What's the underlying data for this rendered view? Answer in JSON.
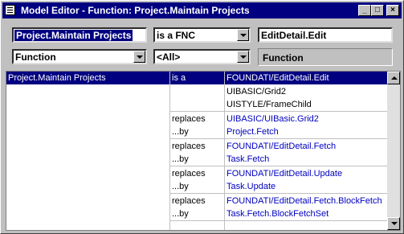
{
  "window": {
    "title": "Model Editor - Function: Project.Maintain Projects"
  },
  "controls": {
    "object_value": "Project.Maintain Projects",
    "relation_value": "is a FNC",
    "target_value": "EditDetail.Edit",
    "type_value": "Function",
    "filter_value": "<All>",
    "type_label": "Function"
  },
  "grid": {
    "rows": [
      {
        "col1": "Project.Maintain Projects",
        "col2": "is a",
        "col3": "FOUNDATI/EditDetail.Edit"
      },
      {
        "col1": "",
        "col2": "",
        "col3": "UIBASIC/Grid2"
      },
      {
        "col1": "",
        "col2": "",
        "col3": "UISTYLE/FrameChild"
      },
      {
        "col1": "",
        "col2": "replaces",
        "col3": "UIBASIC/UIBasic.Grid2"
      },
      {
        "col1": "",
        "col2": "...by",
        "col3": "Project.Fetch"
      },
      {
        "col1": "",
        "col2": "replaces",
        "col3": "FOUNDATI/EditDetail.Fetch"
      },
      {
        "col1": "",
        "col2": "...by",
        "col3": "Task.Fetch"
      },
      {
        "col1": "",
        "col2": "replaces",
        "col3": "FOUNDATI/EditDetail.Update"
      },
      {
        "col1": "",
        "col2": "...by",
        "col3": "Task.Update"
      },
      {
        "col1": "",
        "col2": "replaces",
        "col3": "FOUNDATI/EditDetail.Fetch.BlockFetch"
      },
      {
        "col1": "",
        "col2": "...by",
        "col3": "Task.Fetch.BlockFetchSet"
      }
    ]
  },
  "colors": {
    "title_bar": "#000080",
    "link_blue": "#0000c0",
    "face": "#c0c0c0"
  },
  "icons": [
    "window-menu-icon",
    "minimize-icon",
    "maximize-icon",
    "close-icon",
    "dropdown-arrow-icon",
    "scroll-up-icon",
    "scroll-down-icon"
  ]
}
